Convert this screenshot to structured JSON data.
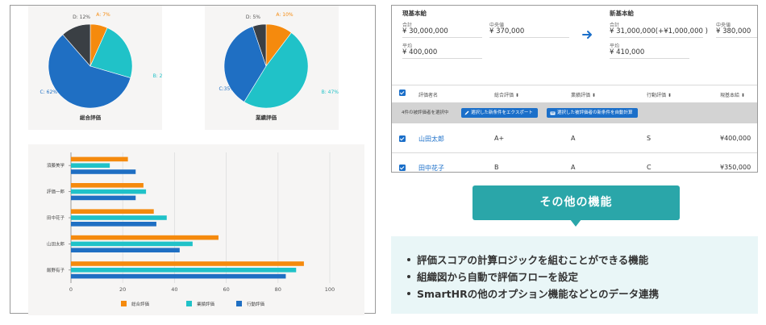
{
  "colors": {
    "orange": "#f58a0d",
    "teal": "#20c2c8",
    "blue": "#1f6fc3",
    "dark": "#3a3f44",
    "accent": "#1b6fc9",
    "feature_teal": "#2aa6a9"
  },
  "chart_data": [
    {
      "type": "pie",
      "title": "総合評価",
      "slices": [
        {
          "label": "A: 7%",
          "value": 7
        },
        {
          "label": "B: 24%",
          "value": 24
        },
        {
          "label": "C: 62%",
          "value": 62
        },
        {
          "label": "D: 12%",
          "value": 12
        }
      ]
    },
    {
      "type": "pie",
      "title": "業績評価",
      "slices": [
        {
          "label": "A: 10%",
          "value": 10
        },
        {
          "label": "B: 47%",
          "value": 47
        },
        {
          "label": "C:35%",
          "value": 35
        },
        {
          "label": "D: 5%",
          "value": 5
        }
      ]
    },
    {
      "type": "bar",
      "orientation": "horizontal",
      "categories": [
        "須藤美学",
        "評価一郎",
        "田中花子",
        "山田太郎",
        "飯野有子"
      ],
      "series": [
        {
          "name": "総合評価",
          "values": [
            22,
            28,
            32,
            57,
            90
          ]
        },
        {
          "name": "業績評価",
          "values": [
            15,
            29,
            37,
            47,
            87
          ]
        },
        {
          "name": "行動評価",
          "values": [
            25,
            25,
            33,
            42,
            83
          ]
        }
      ],
      "xticks": [
        0,
        20,
        40,
        60,
        80,
        100
      ],
      "xlim": [
        0,
        100
      ],
      "grid": true,
      "legend_position": "bottom"
    }
  ],
  "salary": {
    "current_title": "現基本給",
    "new_title": "新基本給",
    "total_label": "合計",
    "median_label": "中央値",
    "average_label": "平均",
    "current_total": "¥ 30,000,000",
    "current_median": "¥ 370,000",
    "current_average": "¥ 400,000",
    "new_total": "¥ 31,000,000(+¥1,000,000 )",
    "new_median": "¥ 380,000",
    "new_average": "¥ 410,000"
  },
  "table": {
    "headers": [
      "評価者名",
      "総合評価 ⬍",
      "業績評価 ⬍",
      "行動評価 ⬍",
      "現基本給 ⬍"
    ],
    "selection_text": "4件の被評価者を選択中",
    "export_button": "選択した新条件をエクスポート",
    "calc_button": "選択した被評価者の新条件を自動計算",
    "rows": [
      {
        "name": "山田太郎",
        "overall": "A+",
        "performance": "A",
        "behavior": "S",
        "salary": "¥400,000"
      },
      {
        "name": "田中花子",
        "overall": "B",
        "performance": "A",
        "behavior": "C",
        "salary": "¥350,000"
      }
    ]
  },
  "features": {
    "title": "その他の機能",
    "items": [
      "評価スコアの計算ロジックを組むことができる機能",
      "組織図から自動で評価フローを設定",
      "SmartHRの他のオプション機能などとのデータ連携"
    ]
  }
}
